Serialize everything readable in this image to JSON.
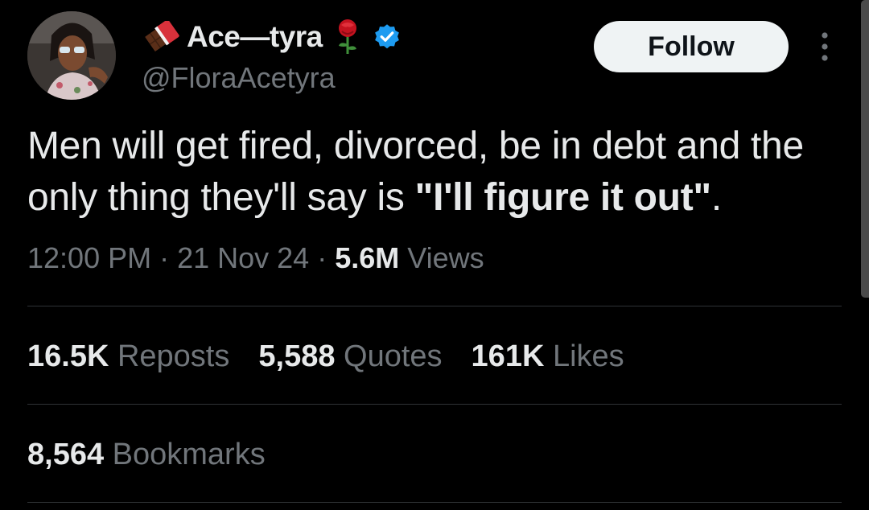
{
  "author": {
    "display_name": "Ace—tyra",
    "handle": "@FloraAcetyra",
    "verified": true,
    "emoji_before": "chocolate-bar-icon",
    "emoji_after": "rose-icon"
  },
  "actions": {
    "follow_label": "Follow",
    "more_icon": "more-vertical-icon"
  },
  "tweet": {
    "text_part1": "Men will get fired, divorced, be in debt and the only thing they'll say is ",
    "text_bold": "\"I'll figure it out\"",
    "text_end": "."
  },
  "meta": {
    "time": "12:00 PM",
    "sep1": " · ",
    "date": "21 Nov 24",
    "sep2": " · ",
    "views_count": "5.6M",
    "views_label": " Views"
  },
  "stats": {
    "reposts_count": "16.5K",
    "reposts_label": " Reposts",
    "quotes_count": "5,588",
    "quotes_label": " Quotes",
    "likes_count": "161K",
    "likes_label": " Likes",
    "bookmarks_count": "8,564",
    "bookmarks_label": " Bookmarks"
  },
  "colors": {
    "background": "#000000",
    "text_primary": "#e7e9ea",
    "text_secondary": "#71767b",
    "divider": "#2f3336",
    "verified_blue": "#1d9bf0",
    "follow_bg": "#eff3f4"
  }
}
